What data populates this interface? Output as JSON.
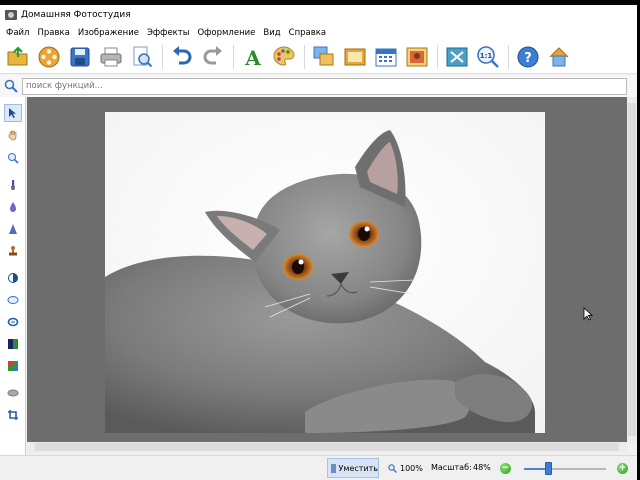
{
  "window": {
    "title": "Домашняя Фотостудия"
  },
  "menu": {
    "items": [
      "Файл",
      "Правка",
      "Изображение",
      "Эффекты",
      "Оформление",
      "Вид",
      "Справка"
    ]
  },
  "toolbar": {
    "buttons": [
      {
        "icon": "open-folder-icon"
      },
      {
        "icon": "film-reel-icon"
      },
      {
        "icon": "save-icon"
      },
      {
        "icon": "print-icon"
      },
      {
        "icon": "print-preview-icon"
      },
      {
        "icon": "undo-icon"
      },
      {
        "icon": "redo-icon"
      },
      {
        "icon": "text-icon",
        "glyph": "A"
      },
      {
        "icon": "palette-icon"
      },
      {
        "icon": "layers-icon"
      },
      {
        "icon": "frame-icon"
      },
      {
        "icon": "calendar-icon"
      },
      {
        "icon": "collage-icon"
      },
      {
        "icon": "fit-window-icon"
      },
      {
        "icon": "actual-size-icon",
        "glyph": "1:1"
      },
      {
        "icon": "help-icon",
        "glyph": "?"
      },
      {
        "icon": "home-icon"
      }
    ]
  },
  "search": {
    "placeholder": "поиск функций..."
  },
  "tools": [
    {
      "icon": "pointer-icon",
      "active": true
    },
    {
      "icon": "hand-icon"
    },
    {
      "icon": "zoom-tool-icon"
    },
    {
      "icon": "brush-icon"
    },
    {
      "icon": "drop-icon"
    },
    {
      "icon": "sharpen-cone-icon"
    },
    {
      "icon": "stamp-icon"
    },
    {
      "icon": "contrast-icon"
    },
    {
      "icon": "ellipse-select-icon"
    },
    {
      "icon": "lasso-icon"
    },
    {
      "icon": "gradient-icon"
    },
    {
      "icon": "color-replace-icon"
    },
    {
      "icon": "eraser-icon"
    },
    {
      "icon": "crop-icon"
    }
  ],
  "status": {
    "fit_label": "Уместить",
    "zoom100_label": "100%",
    "scale_label": "Масштаб:",
    "scale_value": "48%",
    "zoom_out": "−",
    "zoom_in": "+",
    "zoom_fraction": 0.3
  },
  "colors": {
    "canvas_bg": "#6d6d6d",
    "accent": "#3c7cd3"
  }
}
